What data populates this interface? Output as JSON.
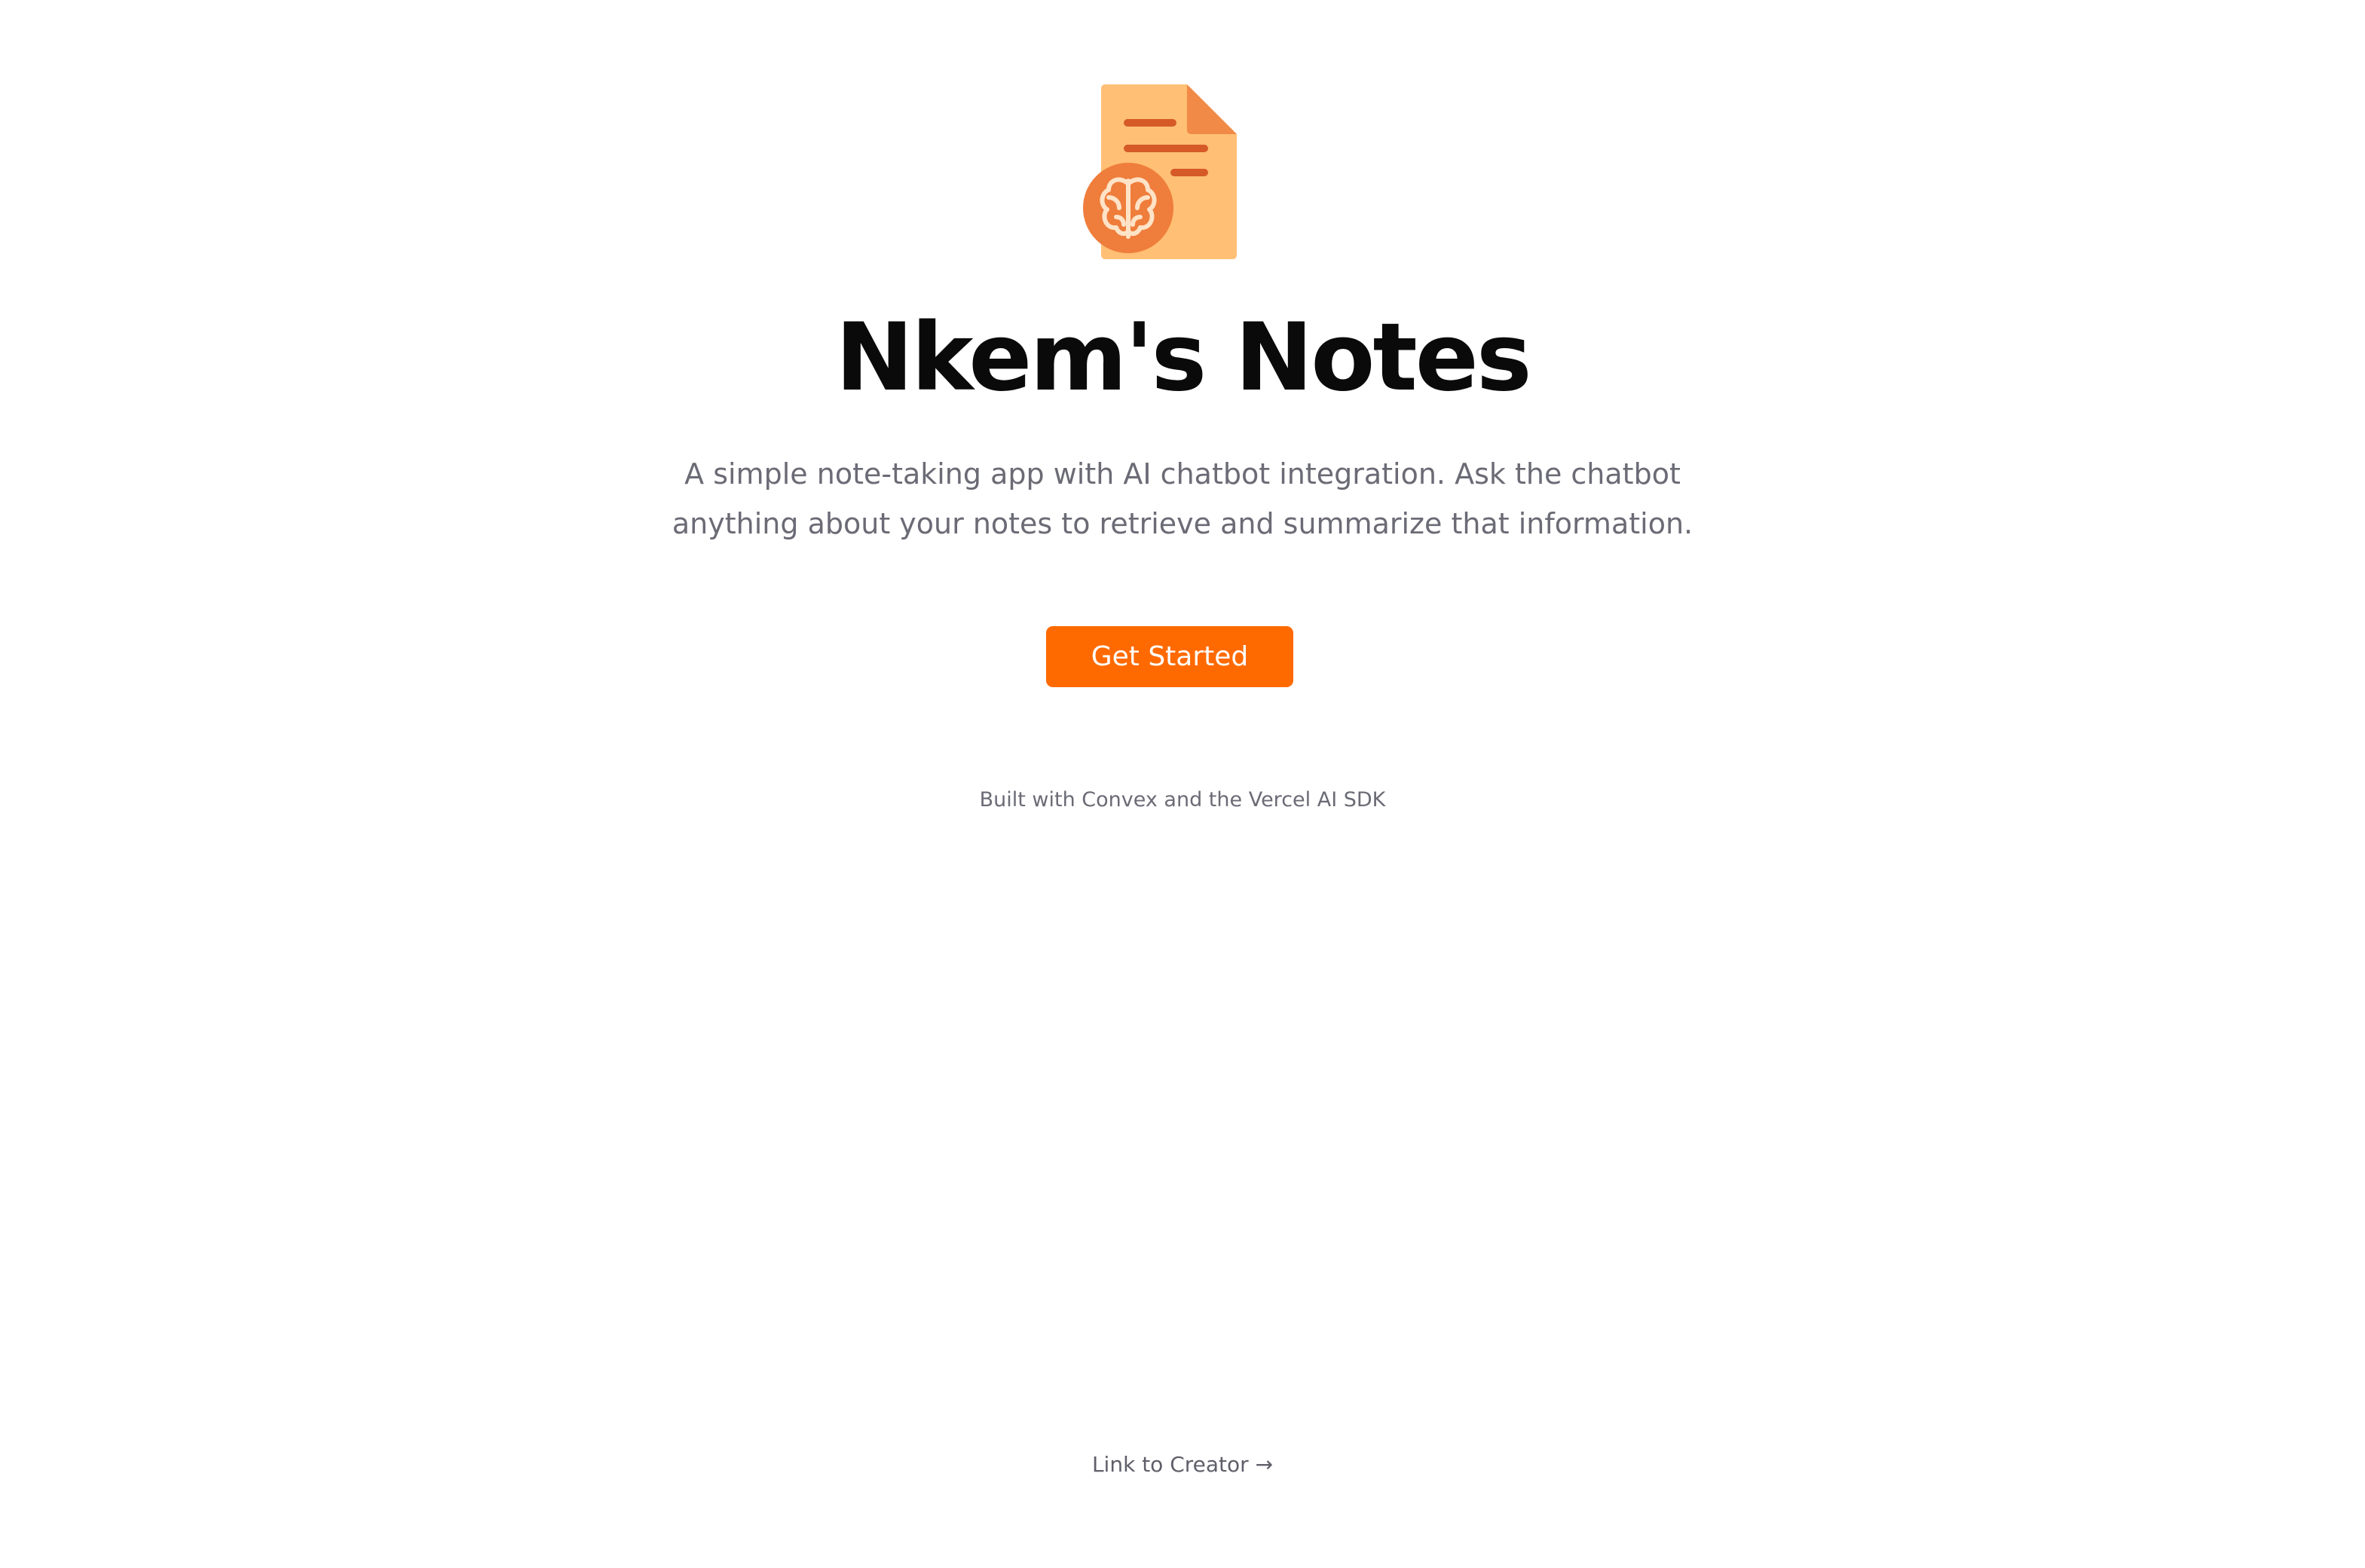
{
  "hero": {
    "logo_icon": "note-with-brain-icon",
    "title": "Nkem's Notes",
    "description": "A simple note-taking app with AI chatbot integration. Ask the chatbot anything about your notes to retrieve and summarize that information.",
    "cta_label": "Get Started",
    "built_with": "Built with Convex and the Vercel AI SDK"
  },
  "footer": {
    "creator_link_label": "Link to Creator",
    "creator_link_arrow": "→"
  },
  "colors": {
    "accent": "#ff6a00",
    "document": "#ffbf75",
    "document_fold": "#f08a46",
    "text_lines": "#d65a28",
    "brain_badge": "#ef7d3b",
    "muted_text": "#6b6b76"
  }
}
